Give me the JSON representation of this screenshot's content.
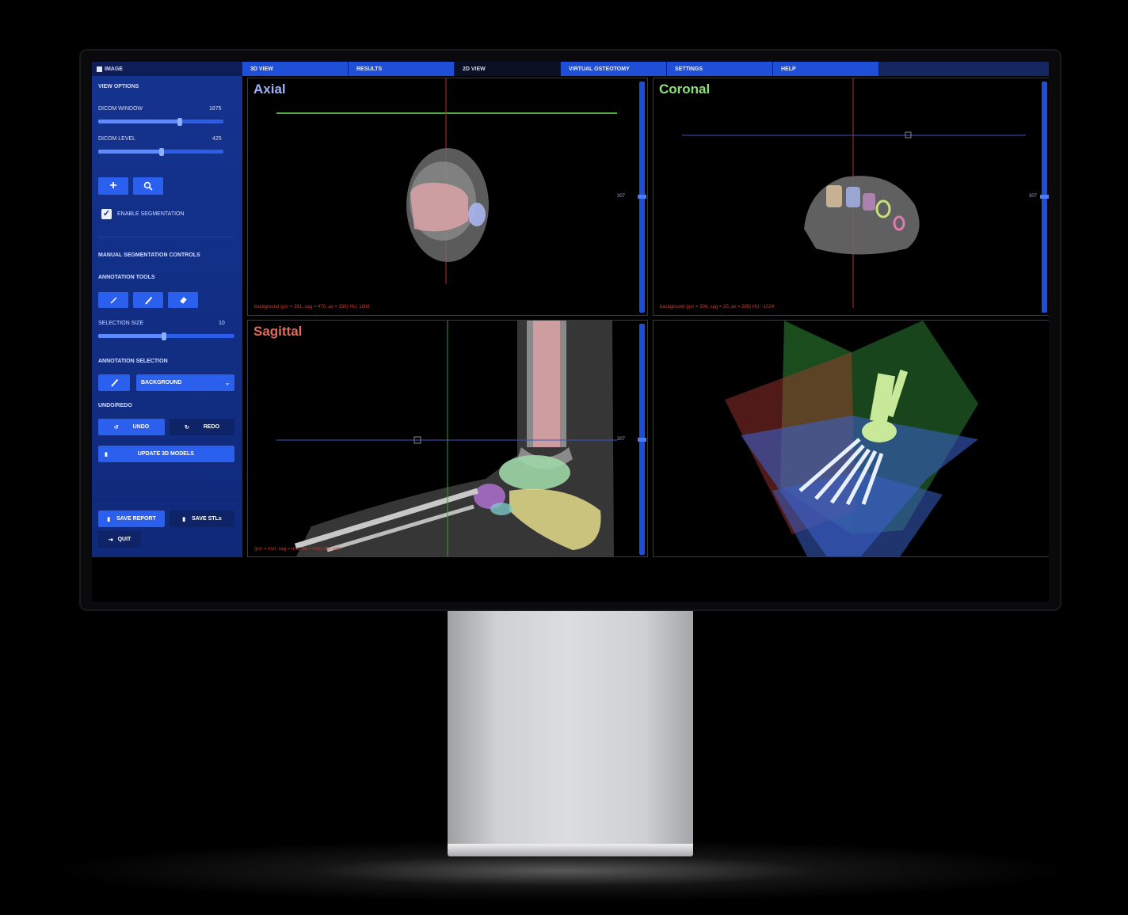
{
  "app": {
    "logo_text": "IMAGE"
  },
  "tabs": [
    {
      "label": "3D VIEW",
      "active": false
    },
    {
      "label": "RESULTS",
      "active": false
    },
    {
      "label": "2D VIEW",
      "active": true
    },
    {
      "label": "VIRTUAL OSTEOTOMY",
      "active": false
    },
    {
      "label": "SETTINGS",
      "active": false
    },
    {
      "label": "HELP",
      "active": false
    }
  ],
  "sidebar": {
    "view_options": "VIEW OPTIONS",
    "dicom_window": {
      "label": "DICOM WINDOW",
      "value": "1875",
      "level": 0.65
    },
    "dicom_level": {
      "label": "DICOM LEVEL",
      "value": "425",
      "level": 0.5
    },
    "enable_segmentation": {
      "label": "ENABLE SEGMENTATION",
      "checked": true
    },
    "manual_segmentation": "MANUAL SEGMENTATION CONTROLS",
    "annotation_tools": "ANNOTATION TOOLS",
    "selection_size": {
      "label": "SELECTION SIZE",
      "value": "10",
      "level": 0.52
    },
    "annotation_selection": "ANNOTATION SELECTION",
    "annotation_dropdown": "BACKGROUND",
    "undo_redo": "UNDO/REDO",
    "undo_label": "UNDO",
    "redo_label": "REDO",
    "update_models": "UPDATE 3D MODELS",
    "save_report": "SAVE REPORT",
    "save_stls": "SAVE STLs",
    "quit": "QUIT"
  },
  "viewports": {
    "axial": {
      "title": "Axial",
      "title_color": "#9bb4ff",
      "slice": "307",
      "info": "background (psr = 391, sag = 470, ax = 336) HU: 1808"
    },
    "coronal": {
      "title": "Coronal",
      "title_color": "#8ee07a",
      "slice": "307",
      "info": "background (psr = 306, sag = 20, ax = 285) HU: -1024"
    },
    "sagittal": {
      "title": "Sagittal",
      "title_color": "#e06a5e",
      "slice": "307",
      "info": "(psr = nnn, sag = nnn, ax = nnn) HU: nnn"
    }
  },
  "colors": {
    "accent": "#1f4fd6",
    "sidebar": "#14338f",
    "axial_line": "#4caf3c",
    "crosshair_red": "#b0342a",
    "crosshair_green": "#3f9c32",
    "crosshair_blue": "#3a57c9"
  },
  "icons": [
    "plus-icon",
    "magnifier-icon",
    "pen-icon",
    "brush-icon",
    "eraser-icon",
    "undo-icon",
    "redo-icon",
    "file-icon",
    "quit-icon",
    "chevron-down-icon"
  ]
}
